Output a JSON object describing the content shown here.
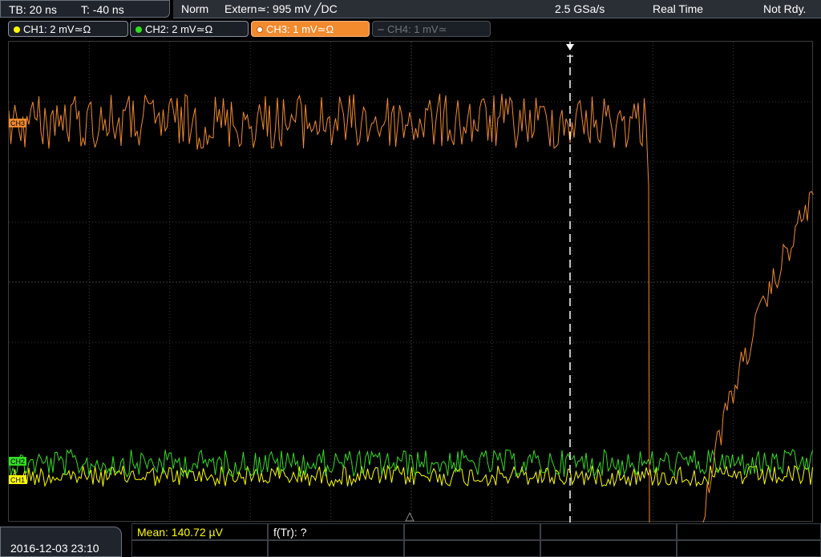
{
  "topbar": {
    "timebase": "TB: 20 ns",
    "trigger_offset": "T: -40 ns",
    "mode": "Norm",
    "trigger": "Extern≃: 995 mV ╱DC",
    "sample_rate": "2.5 GSa/s",
    "acq_mode": "Real Time",
    "state": "Not Rdy."
  },
  "channels": [
    {
      "label": "CH1: 2 mV≃Ω",
      "color": "#ffff00",
      "state": "on"
    },
    {
      "label": "CH2: 2 mV≃Ω",
      "color": "#33dd22",
      "state": "on"
    },
    {
      "label": "CH3: 1 mV≃Ω",
      "color": "#f28a2e",
      "state": "active"
    },
    {
      "label": "CH4: 1 mV≃",
      "color": "#6e747c",
      "state": "off"
    }
  ],
  "trigger_marker": "T",
  "markers": {
    "ch3": "CH3",
    "ch2": "CH2",
    "ch1": "CH1"
  },
  "measurement": {
    "mean": "Mean: 140.72 µV",
    "ftr": "f(Tr): ?"
  },
  "datetime": "2016-12-03 23:10",
  "colors": {
    "ch1": "#ffff00",
    "ch2": "#33dd22",
    "ch3": "#f28a2e",
    "grid": "#3a3a3a",
    "trigger_line": "#ffffff"
  }
}
